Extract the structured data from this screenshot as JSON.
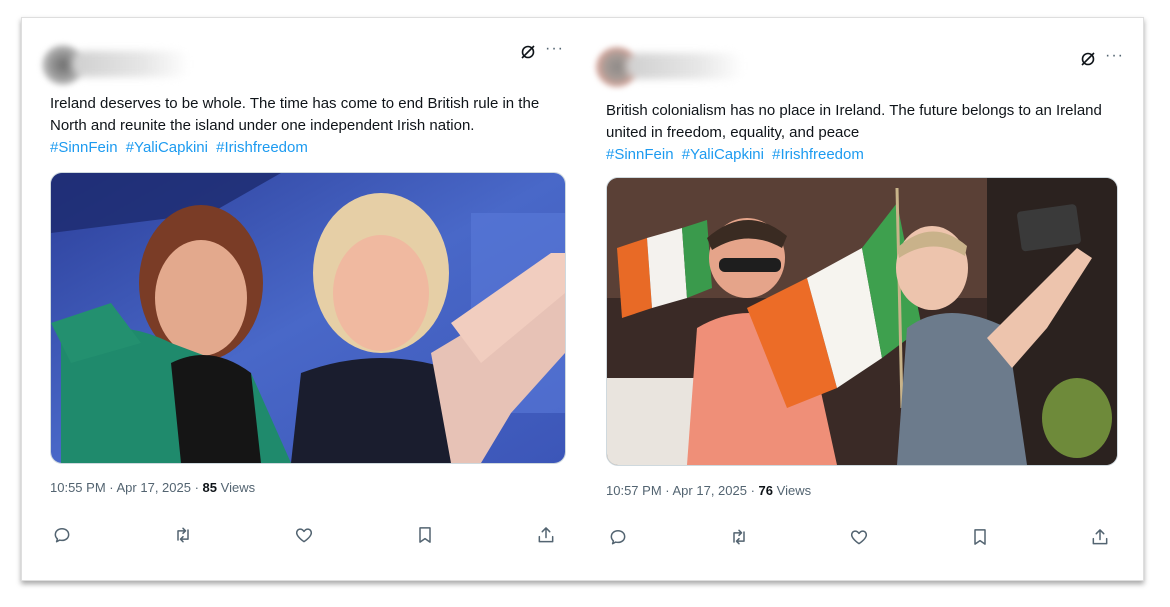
{
  "tweets": [
    {
      "text": "Ireland deserves to be whole. The time has come to end British rule in the North and reunite the island under one independent Irish nation.",
      "hashtags": [
        "#SinnFein",
        "#YaliCapkini",
        "#Irishfreedom"
      ],
      "time": "10:55 PM",
      "date": "Apr 17, 2025",
      "views_count": "85",
      "views_label": "Views",
      "more_label": "···"
    },
    {
      "text": "British colonialism has no place in Ireland. The future belongs to an Ireland united in freedom, equality, and peace",
      "hashtags": [
        "#SinnFein",
        "#YaliCapkini",
        "#Irishfreedom"
      ],
      "time": "10:57 PM",
      "date": "Apr 17, 2025",
      "views_count": "76",
      "views_label": "Views",
      "more_label": "···"
    }
  ],
  "colors": {
    "hashtag": "#1d9bf0",
    "secondary_text": "#536471",
    "primary_text": "#0f1419"
  },
  "icons": [
    "grok-icon",
    "more-icon",
    "reply-icon",
    "retweet-icon",
    "like-icon",
    "bookmark-icon",
    "share-icon"
  ]
}
